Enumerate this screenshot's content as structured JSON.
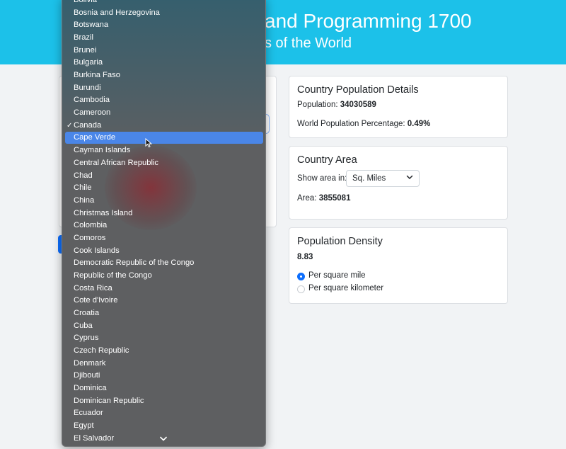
{
  "header": {
    "title": "and Programming 1700",
    "subtitle": "s of the World",
    "bg_color": "#1cc1e9"
  },
  "population_card": {
    "title": "Country Population Details",
    "population_label": "Population:",
    "population_value": "34030589",
    "percentage_label": "World Population Percentage:",
    "percentage_value": "0.49%"
  },
  "area_card": {
    "title": "Country Area",
    "show_area_label": "Show area in:",
    "unit_selected": "Sq. Miles",
    "area_label": "Area:",
    "area_value": "3855081"
  },
  "density_card": {
    "title": "Population Density",
    "value": "8.83",
    "options": [
      {
        "label": "Per square mile",
        "checked": true
      },
      {
        "label": "Per square kilometer",
        "checked": false
      }
    ]
  },
  "dropdown": {
    "selected_country": "Canada",
    "hover_country": "Cape Verde",
    "options": [
      "Bolivia",
      "Bosnia and Herzegovina",
      "Botswana",
      "Brazil",
      "Brunei",
      "Bulgaria",
      "Burkina Faso",
      "Burundi",
      "Cambodia",
      "Cameroon",
      "Canada",
      "Cape Verde",
      "Cayman Islands",
      "Central African Republic",
      "Chad",
      "Chile",
      "China",
      "Christmas Island",
      "Colombia",
      "Comoros",
      "Cook Islands",
      "Democratic Republic of the Congo",
      "Republic of the Congo",
      "Costa Rica",
      "Cote d'Ivoire",
      "Croatia",
      "Cuba",
      "Cyprus",
      "Czech Republic",
      "Denmark",
      "Djibouti",
      "Dominica",
      "Dominican Republic",
      "Ecuador",
      "Egypt",
      "El Salvador"
    ],
    "check_glyph": "✓"
  },
  "icons": {
    "select_chevron": "chevron-down-icon",
    "scroll_down": "chevron-down-icon",
    "cursor": "mouse-pointer-icon"
  },
  "colors": {
    "accent": "#0d6efd",
    "highlight": "#4a86e8"
  }
}
